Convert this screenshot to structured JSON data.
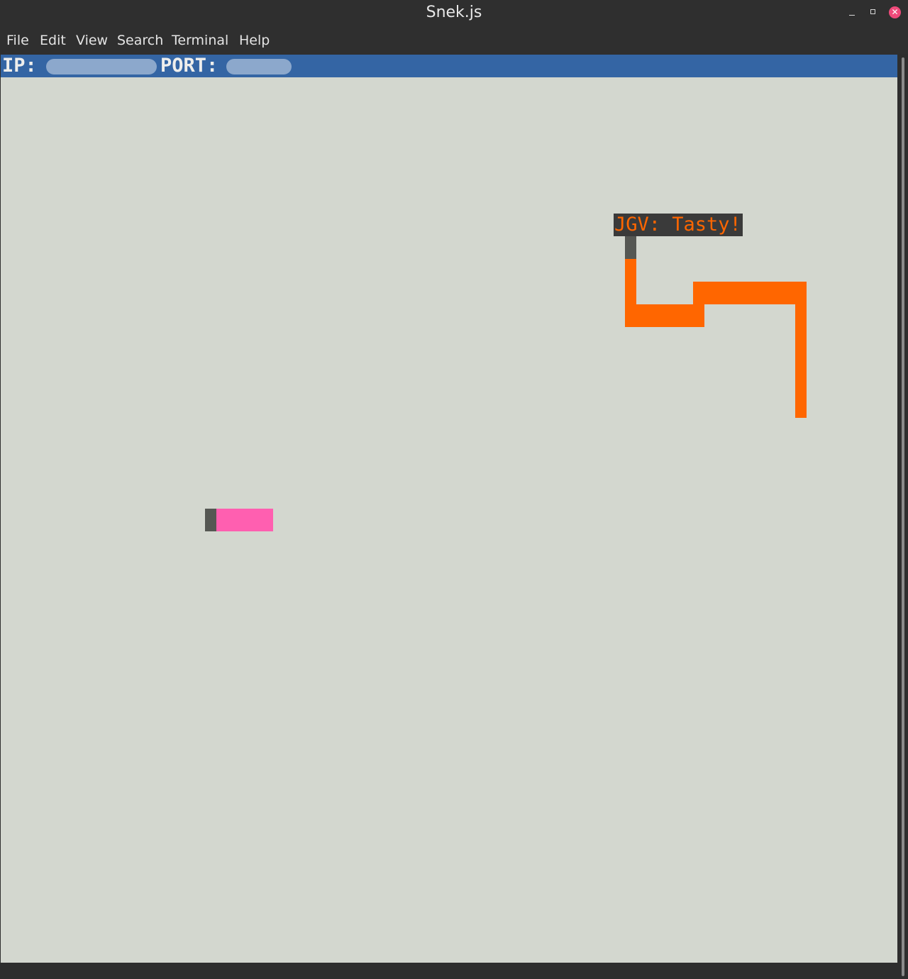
{
  "window": {
    "title": "Snek.js"
  },
  "menu": {
    "items": [
      "File",
      "Edit",
      "View",
      "Search",
      "Terminal",
      "Help"
    ]
  },
  "status": {
    "ip_label": "IP:",
    "port_label": "PORT:"
  },
  "game": {
    "message": "JGV: Tasty!",
    "colors": {
      "background": "#d3d7cf",
      "status_bar": "#3465a4",
      "snake_head": "#555753",
      "player_orange": "#ff6600",
      "player_pink": "#ff5fb0",
      "speech_background": "#3a3a3a"
    }
  }
}
